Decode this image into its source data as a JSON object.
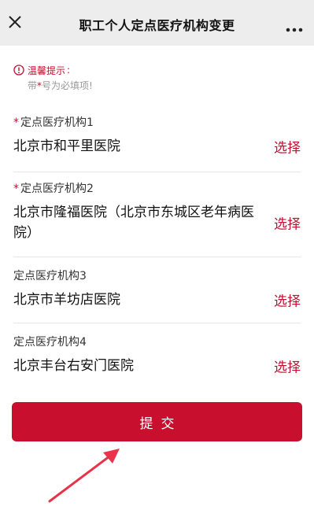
{
  "header": {
    "title": "职工个人定点医疗机构变更",
    "close_icon": "close-icon",
    "more_icon": "more-dots-icon"
  },
  "tips": {
    "title": "温馨提示",
    "colon": ":",
    "note_prefix": "带",
    "note_star": "*",
    "note_suffix": "号为必填项!"
  },
  "fields": [
    {
      "label": "定点医疗机构1",
      "required": "*",
      "value": "北京市和平里医院",
      "action": "选择"
    },
    {
      "label": "定点医疗机构2",
      "required": "*",
      "value": "北京市隆福医院（北京市东城区老年病医院）",
      "action": "选择"
    },
    {
      "label": "定点医疗机构3",
      "value": "北京市羊坊店医院",
      "action": "选择"
    },
    {
      "label": "定点医疗机构4",
      "value": "北京丰台右安门医院",
      "action": "选择"
    }
  ],
  "submit": {
    "label": "提交"
  },
  "colors": {
    "accent": "#c8102e",
    "header_bg": "#ededed",
    "arrow": "#e8334a"
  }
}
